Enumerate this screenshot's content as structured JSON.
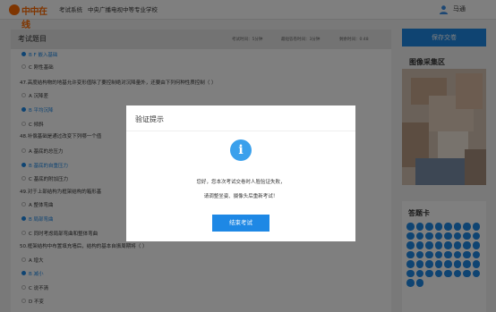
{
  "header": {
    "logo_text": "中中在线",
    "logo_sub": "ZHONGZHONG",
    "system_label": "考试系统",
    "school_name": "中央广播电视中等专业学校",
    "user_name": "马通"
  },
  "exam": {
    "title": "考试题目",
    "stats": [
      {
        "label": "考试时间：5分钟"
      },
      {
        "label": "最短答卷时间：3分钟"
      },
      {
        "label": "剩余时间：0:48"
      }
    ],
    "lines": [
      {
        "kind": "option",
        "text": "B F 嵌入基础",
        "selected": true
      },
      {
        "kind": "option",
        "text": "C 刚性基础",
        "selected": false
      },
      {
        "kind": "question",
        "text": "47.高度结构物的地基允许变形值除了要控制绝对沉降量外，还要由下列何种性质控制（   ）"
      },
      {
        "kind": "option",
        "text": "A 沉降差",
        "selected": false
      },
      {
        "kind": "option",
        "text": "B 平均沉降",
        "selected": true
      },
      {
        "kind": "option",
        "text": "C 倾斜",
        "selected": false
      },
      {
        "kind": "question",
        "text": "48.补偿基础是通过改变下列哪一个值"
      },
      {
        "kind": "option",
        "text": "A 基底的总压力",
        "selected": false
      },
      {
        "kind": "option",
        "text": "B 基底的自重压力",
        "selected": true
      },
      {
        "kind": "option",
        "text": "C 基底的附加压力",
        "selected": false
      },
      {
        "kind": "question",
        "text": "49.对于上部结构为框架结构的箱形基"
      },
      {
        "kind": "option",
        "text": "A 整体弯曲",
        "selected": false
      },
      {
        "kind": "option",
        "text": "B 局部弯曲",
        "selected": true
      },
      {
        "kind": "option",
        "text": "C 同时考虑局部弯曲和整体弯曲",
        "selected": false
      },
      {
        "kind": "question",
        "text": "50.框架结构中布置填充墙后，结构的基本自振周期将（   ）"
      },
      {
        "kind": "option",
        "text": "A 增大",
        "selected": false
      },
      {
        "kind": "option",
        "text": "B 减小",
        "selected": true
      },
      {
        "kind": "option",
        "text": "C 说不清",
        "selected": false
      },
      {
        "kind": "option",
        "text": "D 不变",
        "selected": false
      }
    ]
  },
  "sidebar": {
    "save_label": "保存交卷",
    "image_title": "图像采集区",
    "card_title": "答题卡",
    "answer_count": 50
  },
  "modal": {
    "title": "验证提示",
    "icon": "info-icon",
    "line1": "您好，您本次考试交卷时人脸验证失败，",
    "line2": "请调整坐姿、摄像头后重新考试！",
    "button_label": "结束考试"
  },
  "colors": {
    "accent": "#1e88e5",
    "info_icon": "#3aa0ec",
    "brand": "#ff6a00"
  }
}
